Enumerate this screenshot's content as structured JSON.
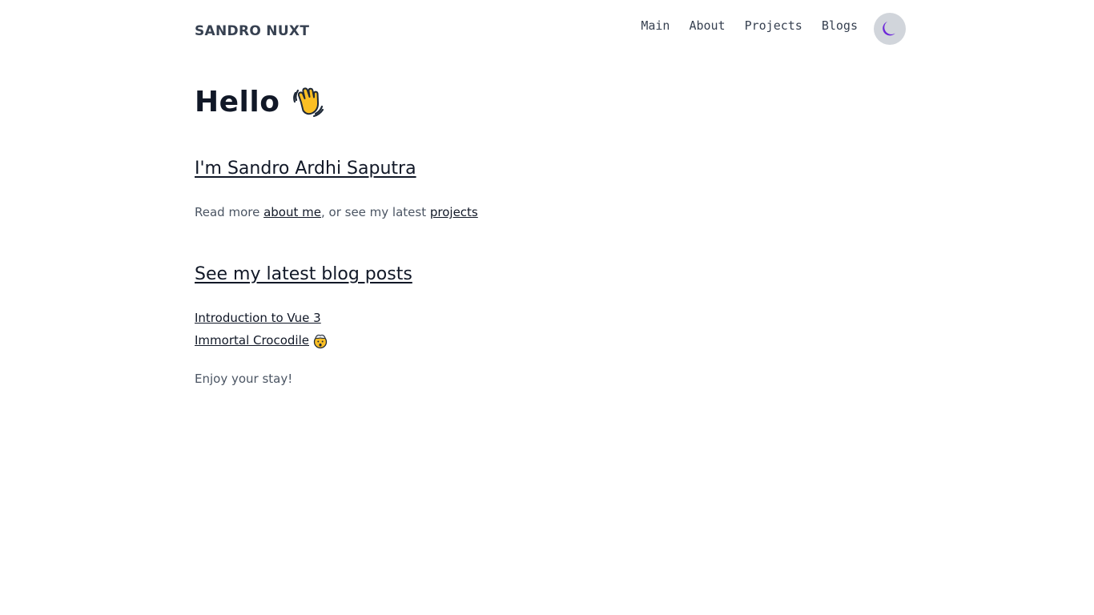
{
  "header": {
    "brand": "SANDRO NUXT",
    "nav": [
      {
        "label": "Main"
      },
      {
        "label": "About"
      },
      {
        "label": "Projects"
      },
      {
        "label": "Blogs"
      }
    ],
    "theme_toggle_icon": "moon-icon"
  },
  "main": {
    "greeting": "Hello",
    "greeting_icon": "waving-hand-icon",
    "intro": "I'm Sandro Ardhi Saputra",
    "readmore": {
      "prefix": "Read more ",
      "about_link": "about me",
      "middle": ", or see my latest ",
      "projects_link": "projects"
    },
    "blog_heading": "See my latest blog posts",
    "posts": [
      {
        "title": "Introduction to Vue 3"
      },
      {
        "title": "Immortal Crocodile",
        "icon": "exploding-head-icon"
      }
    ],
    "closing": "Enjoy your stay!"
  },
  "colors": {
    "text": "#111827",
    "muted": "#4b5563",
    "toggle_bg": "#d1d5db",
    "moon": "#6d28d9"
  }
}
